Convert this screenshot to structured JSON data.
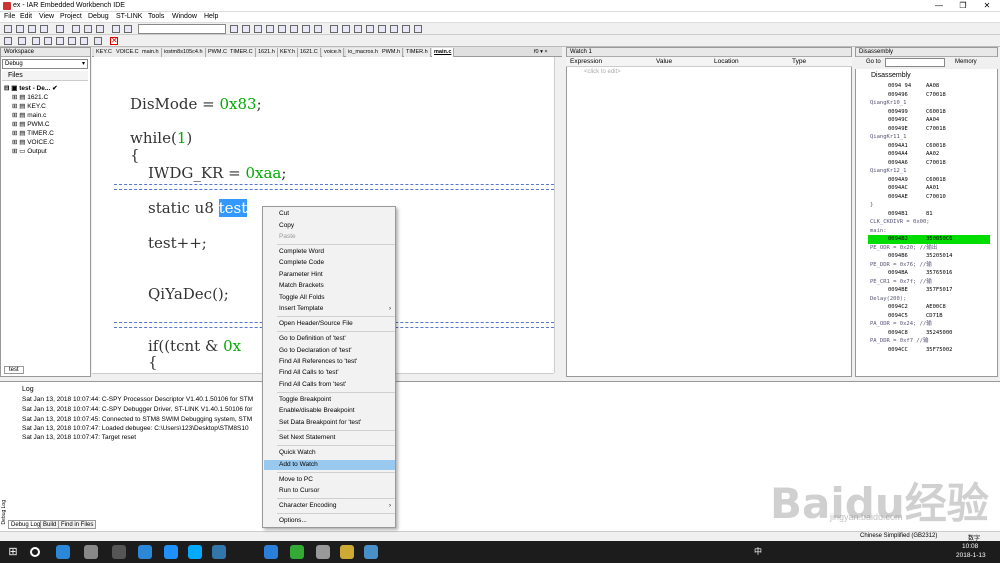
{
  "window": {
    "title": "ex - IAR Embedded Workbench IDE",
    "min": "—",
    "max": "❐",
    "close": "✕"
  },
  "menu": [
    "File",
    "Edit",
    "View",
    "Project",
    "Debug",
    "ST-LINK",
    "Tools",
    "Window",
    "Help"
  ],
  "workspace": {
    "header": "Workspace",
    "config": "Debug",
    "files_label": "Files",
    "tree": [
      "test - De...",
      "1621.C",
      "KEY.C",
      "main.c",
      "PWM.C",
      "TIMER.C",
      "VOICE.C",
      "Output"
    ],
    "footer_tab": "test"
  },
  "tabs": [
    "KEY.C",
    "VOICE.C",
    "main.h",
    "iostm8s105c4.h",
    "PWM.C",
    "TIMER.C",
    "1621.h",
    "KEY.h",
    "1621.C",
    "voice.h",
    "io_macros.h",
    "PWM.h",
    "TIMER.h",
    "main.c"
  ],
  "tabs_more": "f0 ▾ ×",
  "code": {
    "l1a": "DisMode = ",
    "l1b": "0x83",
    "l1c": ";",
    "l2a": "while(",
    "l2b": "1",
    "l2c": ")",
    "l3": "{",
    "l4a": "IWDG_KR = ",
    "l4b": "0xaa",
    "l4c": ";",
    "l5a": "static u8 ",
    "l5b": "test",
    "l6": "test++;",
    "l7": "QiYaDec();",
    "l8a": "if((tcnt & ",
    "l8b": "0x",
    "l9": "{"
  },
  "watch": {
    "header": "Watch 1",
    "cols": [
      "Expression",
      "Value",
      "Location",
      "Type"
    ],
    "placeholder": "<click to edit>"
  },
  "disasm": {
    "header": "Disassembly",
    "goto": "Go to",
    "memory": "Memory",
    "title": "Disassembly",
    "rows": [
      [
        "0094 94",
        "AA08",
        ""
      ],
      [
        "009496",
        "C70018",
        ""
      ],
      [
        "QiangKr10_1",
        "",
        "lbl"
      ],
      [
        "009499",
        "C60018",
        ""
      ],
      [
        "00949C",
        "AA04",
        ""
      ],
      [
        "00949E",
        "C70018",
        ""
      ],
      [
        "QiangKr11_1",
        "",
        "lbl"
      ],
      [
        "0094A1",
        "C60018",
        ""
      ],
      [
        "0094A4",
        "AA02",
        ""
      ],
      [
        "0094A6",
        "C70018",
        ""
      ],
      [
        "QiangKr12_1",
        "",
        "lbl"
      ],
      [
        "0094A9",
        "C60018",
        ""
      ],
      [
        "0094AC",
        "AA01",
        ""
      ],
      [
        "0094AE",
        "C70010",
        ""
      ],
      [
        "}",
        "",
        "lbl"
      ],
      [
        "0094B1",
        "81",
        ""
      ],
      [
        "CLK_CKDIVR = 0x00;",
        "",
        "lbl"
      ],
      [
        "main:",
        "",
        "lbl"
      ],
      [
        "0094B2",
        "350050C6",
        "hl"
      ],
      [
        "PE_ODR = 0x20;   //输出",
        "",
        "lbl"
      ],
      [
        "0094B6",
        "35205014",
        ""
      ],
      [
        "PE_DDR = 0x76;   //输",
        "",
        "lbl"
      ],
      [
        "0094BA",
        "35765016",
        ""
      ],
      [
        "PE_CR1 = 0x7f;   //输",
        "",
        "lbl"
      ],
      [
        "0094BE",
        "357F5017",
        ""
      ],
      [
        "Delay(200);",
        "",
        "lbl"
      ],
      [
        "0094C2",
        "AE00C8",
        ""
      ],
      [
        "0094C5",
        "CD71B",
        ""
      ],
      [
        "PA_ODR = 0x24;   //输",
        "",
        "lbl"
      ],
      [
        "0094C8",
        "35245000",
        ""
      ],
      [
        "PA_DDR = 0xf7    //输",
        "",
        "lbl"
      ],
      [
        "0094CC",
        "35F75002",
        ""
      ]
    ]
  },
  "log": {
    "header": "Log",
    "lines": [
      "Sat Jan 13, 2018 10:07:44: C-SPY Processor Descriptor V1.40.1.50106 for STM",
      "Sat Jan 13, 2018 10:07:44: C-SPY Debugger Driver, ST-LINK V1.40.1.50106 for",
      "Sat Jan 13, 2018 10:07:45: Connected to STM8 SWIM Debugging system, STM",
      "Sat Jan 13, 2018 10:07:47: Loaded debugee: C:\\Users\\123\\Desktop\\STM8S10",
      "Sat Jan 13, 2018 10:07:47: Target reset"
    ],
    "tabs": [
      "Debug Log",
      "Build",
      "Find in Files"
    ],
    "side": "Debug Log"
  },
  "context_menu": {
    "cut": "Cut",
    "copy": "Copy",
    "paste": "Paste",
    "complete_word": "Complete Word",
    "complete_code": "Complete Code",
    "param_hint": "Parameter Hint",
    "match_brackets": "Match Brackets",
    "toggle_folds": "Toggle All Folds",
    "insert_template": "Insert Template",
    "open_header": "Open Header/Source File",
    "goto_def": "Go to Definition of 'test'",
    "goto_decl": "Go to Declaration of 'test'",
    "find_refs": "Find All References to 'test'",
    "find_calls_to": "Find All Calls to 'test'",
    "find_calls_from": "Find All Calls from 'test'",
    "toggle_bp": "Toggle Breakpoint",
    "enable_bp": "Enable/disable Breakpoint",
    "set_data_bp": "Set Data Breakpoint for 'test'",
    "set_next": "Set Next Statement",
    "quick_watch": "Quick Watch",
    "add_watch": "Add to Watch",
    "move_pc": "Move to PC",
    "run_cursor": "Run to Cursor",
    "char_enc": "Character Encoding",
    "options": "Options..."
  },
  "status": {
    "encoding": "Chinese Simplified (GB2312)",
    "mode": "数字"
  },
  "taskbar": {
    "time": "10:08",
    "date": "2018-1-13",
    "ime": "中"
  },
  "watermark": {
    "brand": "Baidu经验",
    "url": "jingyan.baidu.com"
  },
  "colors": {
    "selection": "#3399ff",
    "current_line": "#00dd00",
    "menu_highlight": "#99c9ef"
  }
}
